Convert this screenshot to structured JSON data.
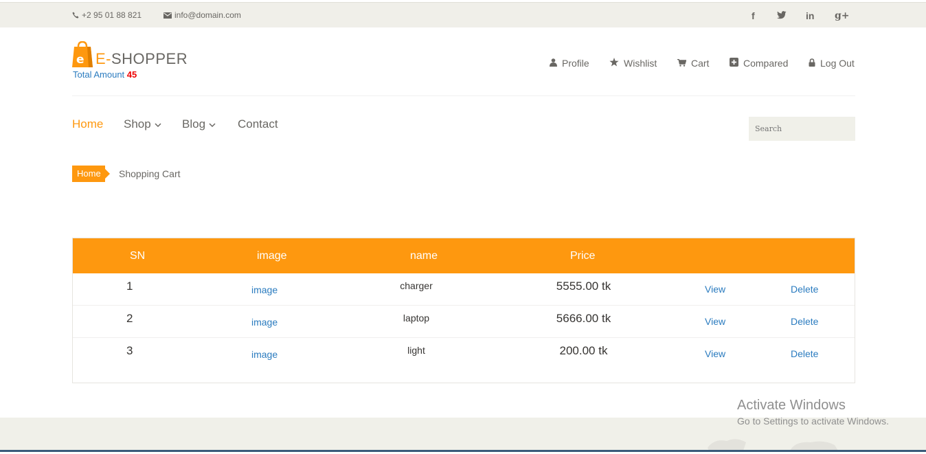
{
  "topbar": {
    "phone": "+2 95 01 88 821",
    "email": "info@domain.com",
    "social": {
      "facebook": "f",
      "twitter": "twitter-icon",
      "linkedin": "in",
      "google_plus": "g+"
    }
  },
  "brand": {
    "name_prefix": "E-",
    "name": "SHOPPER",
    "total_label": "Total Amount",
    "total_value": "45",
    "accent": "#fe980f"
  },
  "user_menu": {
    "profile": "Profile",
    "wishlist": "Wishlist",
    "cart": "Cart",
    "compared": "Compared",
    "logout": "Log Out"
  },
  "nav": {
    "home": "Home",
    "shop": "Shop",
    "blog": "Blog",
    "contact": "Contact"
  },
  "search": {
    "placeholder": "Search"
  },
  "breadcrumb": {
    "home": "Home",
    "current": "Shopping Cart"
  },
  "cart_table": {
    "headers": {
      "sn": "SN",
      "image": "image",
      "name": "name",
      "price": "Price"
    },
    "rows": [
      {
        "sn": "1",
        "image": "image",
        "name": "charger",
        "price": "5555.00 tk",
        "view": "View",
        "delete": "Delete"
      },
      {
        "sn": "2",
        "image": "image",
        "name": "laptop",
        "price": "5666.00 tk",
        "view": "View",
        "delete": "Delete"
      },
      {
        "sn": "3",
        "image": "image",
        "name": "light",
        "price": "200.00 tk",
        "view": "View",
        "delete": "Delete"
      }
    ]
  },
  "watermark": {
    "title": "Activate Windows",
    "subtitle": "Go to Settings to activate Windows."
  }
}
